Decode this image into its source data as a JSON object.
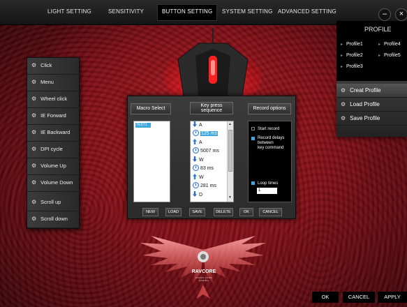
{
  "nav": {
    "tabs": [
      {
        "label": "LIGHT SETTING"
      },
      {
        "label": "SENSITIVITY"
      },
      {
        "label": "BUTTON SETTING"
      },
      {
        "label": "SYSTEM SETTING"
      },
      {
        "label": "ADVANCED SETTING"
      }
    ],
    "active_tab": "BUTTON SETTING",
    "minimize": "–",
    "close": "×"
  },
  "profile": {
    "title": "PROFILE",
    "items": [
      "Profile1",
      "Profile2",
      "Profile3",
      "Profile4",
      "Profile5"
    ],
    "actions": [
      "Creat Profile",
      "Load Profile",
      "Save Profile"
    ]
  },
  "buttons": {
    "items": [
      "Click",
      "Menu",
      "Wheel click",
      "IE Forward",
      "IE Backward",
      "DPI cycle",
      "Volume Up",
      "Volume Down",
      "Scroll up",
      "Scroll down"
    ]
  },
  "macro": {
    "header": {
      "macro_select": "Macro Select",
      "key_press_line1": "Key press",
      "key_press_line2": "sequence",
      "record_options": "Record options"
    },
    "macro_list": [
      "TEST1"
    ],
    "sequence": [
      {
        "kind": "down",
        "text": "A"
      },
      {
        "kind": "delay",
        "text": "125 ms",
        "selected": true
      },
      {
        "kind": "up",
        "text": "A"
      },
      {
        "kind": "delay",
        "text": "5007 ms"
      },
      {
        "kind": "down",
        "text": "W"
      },
      {
        "kind": "delay",
        "text": "83 ms"
      },
      {
        "kind": "up",
        "text": "W"
      },
      {
        "kind": "delay",
        "text": "281 ms"
      },
      {
        "kind": "down",
        "text": "D"
      }
    ],
    "record": {
      "start_record": "Start record",
      "delays_line1": "Record delays",
      "delays_line2": "between",
      "delays_line3": "key command",
      "loop_times": "Loop times",
      "loop_value": "1"
    },
    "footer": {
      "new": "NEW",
      "load": "LOAD",
      "save": "SAVE",
      "delete": "DELETE",
      "ok": "OK",
      "cancel": "CANCEL"
    }
  },
  "brand": {
    "name": "RAVCORE",
    "tagline": "RAVEN CORE GAMING"
  },
  "footer": {
    "ok": "OK",
    "cancel": "CANCEL",
    "apply": "APPLY"
  },
  "colors": {
    "accent": "#3ea7e0",
    "background": "#8f1119",
    "panel": "#2f2f2f"
  }
}
